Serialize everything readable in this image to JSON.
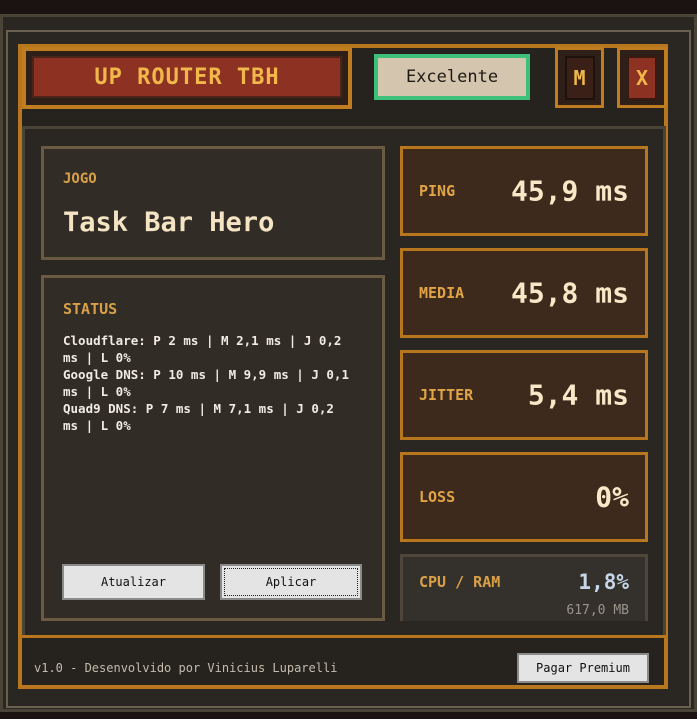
{
  "header": {
    "title": "UP ROUTER TBH",
    "quality": "Excelente",
    "minimize_label": "M",
    "close_label": "X"
  },
  "game": {
    "label": "JOGO",
    "name": "Task Bar Hero"
  },
  "status": {
    "label": "STATUS",
    "lines": [
      "Cloudflare: P 2 ms | M 2,1 ms | J 0,2",
      "ms | L 0%",
      "Google DNS: P 10 ms | M 9,9 ms | J 0,1",
      "ms | L 0%",
      "Quad9 DNS: P 7 ms | M 7,1 ms | J 0,2",
      "ms | L 0%"
    ],
    "refresh_label": "Atualizar",
    "apply_label": "Aplicar"
  },
  "metrics": {
    "ping": {
      "label": "PING",
      "value": "45,9 ms"
    },
    "media": {
      "label": "MEDIA",
      "value": "45,8 ms"
    },
    "jitter": {
      "label": "JITTER",
      "value": "5,4 ms"
    },
    "loss": {
      "label": "LOSS",
      "value": "0%"
    },
    "cpu_ram": {
      "label": "CPU / RAM",
      "cpu": "1,8%",
      "ram": "617,0 MB"
    }
  },
  "footer": {
    "version_text": "v1.0 - Desenvolvido por Vinicius Luparelli",
    "premium_label": "Pagar Premium"
  },
  "colors": {
    "accent_gold": "#b8761e",
    "title_red": "#8d3222",
    "quality_green": "#3cc07a"
  }
}
